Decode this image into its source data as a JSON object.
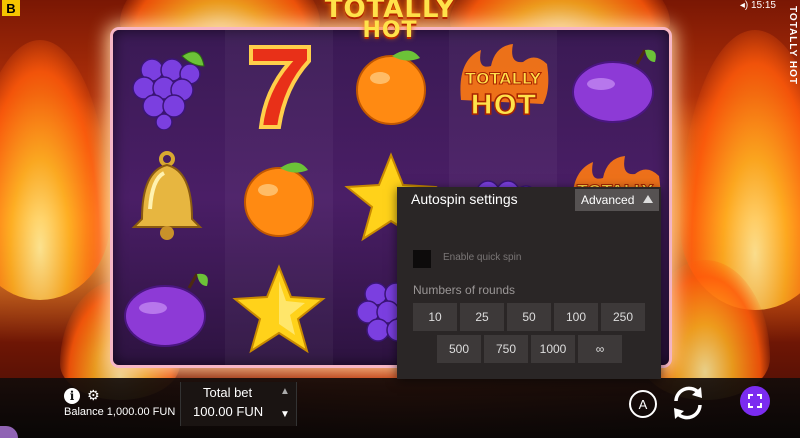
{
  "game": {
    "title_line1": "TOTALLY",
    "title_line2": "HOT",
    "side_title": "TOTALLY HOT",
    "logo_letter": "B",
    "top_right_text": "◂) 15:15"
  },
  "reels": {
    "symbols": [
      [
        "grapes-symbol",
        "seven-symbol",
        "orange-symbol",
        "totally-hot-symbol",
        "plum-symbol"
      ],
      [
        "bell-symbol",
        "orange-symbol",
        "star-symbol",
        "grapes-symbol",
        "totally-hot-symbol"
      ],
      [
        "plum-symbol",
        "star-symbol",
        "grapes-symbol",
        "",
        ""
      ]
    ]
  },
  "bottom_bar": {
    "balance": "Balance 1,000.00 FUN",
    "total_bet_label": "Total bet",
    "total_bet_value": "100.00 FUN",
    "auto_label": "A"
  },
  "autospin": {
    "title": "Autospin settings",
    "advanced_label": "Advanced",
    "quick_spin_label": "Enable quick spin",
    "rounds_label": "Numbers of rounds",
    "rounds_row1": [
      "10",
      "25",
      "50",
      "100",
      "250"
    ],
    "rounds_row2": [
      "500",
      "750",
      "1000",
      "∞"
    ]
  },
  "colors": {
    "accent": "#7b2cf0",
    "title_yellow": "#ffe24a",
    "panel_bg": "#2a2626"
  }
}
